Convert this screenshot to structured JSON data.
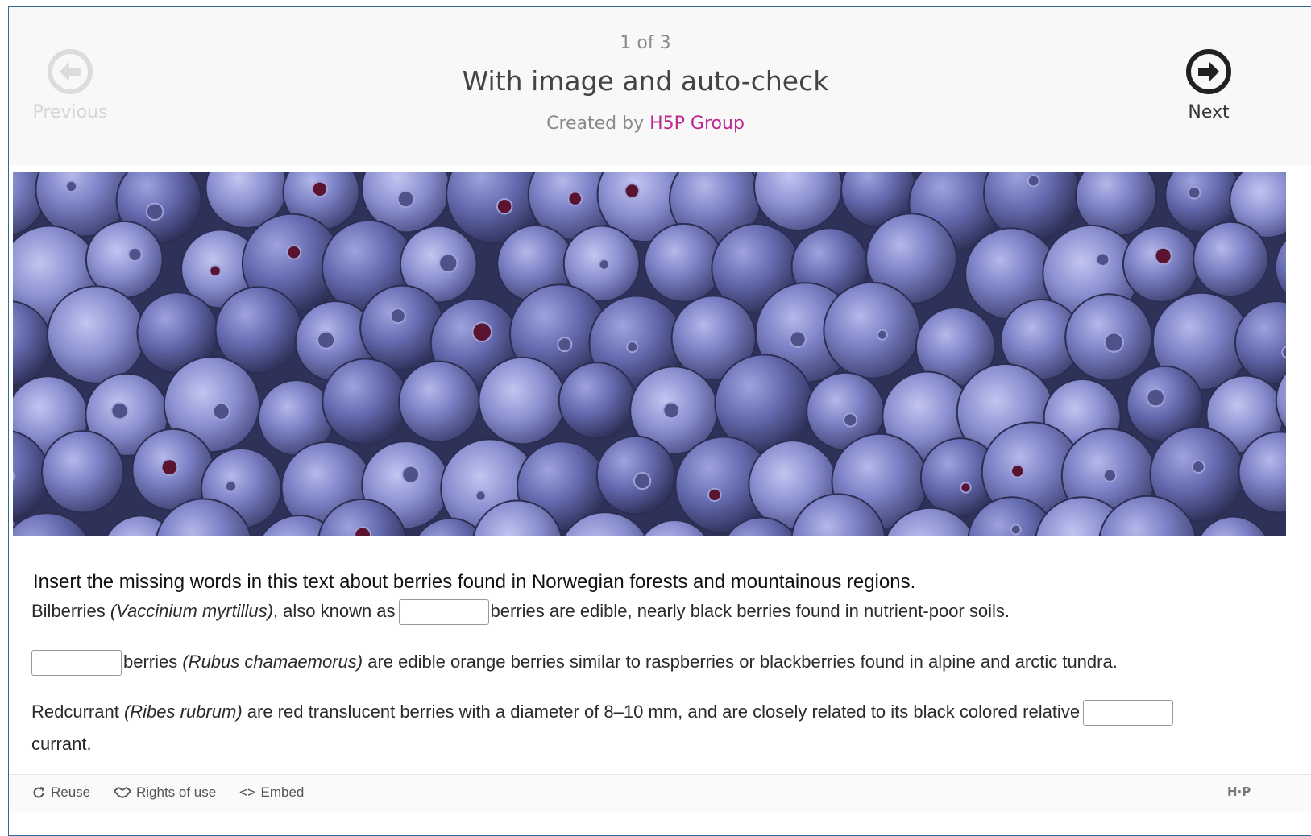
{
  "header": {
    "counter": "1 of 3",
    "title": "With image and auto-check",
    "created_by_prefix": "Created by",
    "author": "H5P Group",
    "previous_label": "Previous",
    "next_label": "Next"
  },
  "content": {
    "instructions": "Insert the missing words in this text about berries found in Norwegian forests and mountainous regions.",
    "paragraph1": {
      "before": "Bilberries ",
      "italic": "(Vaccinium myrtillus)",
      "middle": ", also known as",
      "after": "berries are edible, nearly black berries found in nutrient-poor soils."
    },
    "paragraph2": {
      "before": "berries ",
      "italic": "(Rubus chamaemorus)",
      "after": " are edible orange berries similar to raspberries or blackberries found in alpine and arctic tundra."
    },
    "paragraph3": {
      "before": "Redcurrant ",
      "italic": "(Ribes rubrum)",
      "middle": " are red translucent berries with a diameter of 8–10 mm, and are closely related to its black colored relative",
      "after": "currant."
    },
    "blanks": [
      {
        "value": ""
      },
      {
        "value": ""
      },
      {
        "value": ""
      }
    ]
  },
  "footer": {
    "reuse_label": "Reuse",
    "rights_label": "Rights of use",
    "embed_label": "Embed",
    "logo_text": "H·P"
  },
  "colors": {
    "author_link": "#c0268f",
    "berry_dark": "#4a4f86",
    "berry_light": "#8e94d3"
  },
  "icons": {
    "previous": "arrow-left-circle-icon",
    "next": "arrow-right-circle-icon",
    "reuse": "refresh-icon",
    "rights": "handshake-icon",
    "embed": "code-icon"
  }
}
